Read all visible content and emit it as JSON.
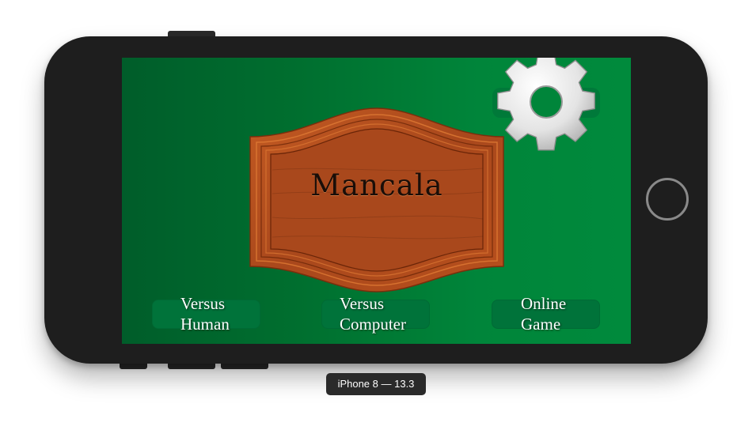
{
  "app": {
    "title": "Mancala"
  },
  "menu": {
    "versus_human": "Versus\nHuman",
    "versus_computer": "Versus\nComputer",
    "online_game": "Online\nGame"
  },
  "icons": {
    "settings": "gear-icon"
  },
  "simulator": {
    "device_label": "iPhone 8 — 13.3"
  },
  "colors": {
    "felt_dark": "#005d2a",
    "felt_light": "#008a3c",
    "wood": "#b5511f",
    "button_fill": "#00733a"
  }
}
